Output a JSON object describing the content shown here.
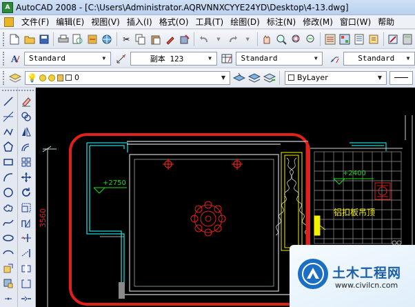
{
  "titlebar": {
    "icon_text": "A",
    "title": "AutoCAD 2008 - [C:\\Users\\Administrator.AQRVNNXCYYE24YD\\Desktop\\4-13.dwg]"
  },
  "menu": {
    "items": [
      "文件(F)",
      "编辑(E)",
      "视图(V)",
      "插入(I)",
      "格式(O)",
      "工具(T)",
      "绘图(D)",
      "标注(N)",
      "修改(M)",
      "窗口(W)",
      "帮助"
    ]
  },
  "styles_toolbar": {
    "text_style": "Standard",
    "dim_style": "副本 123",
    "table_style": "Standard",
    "multileader_style": "Standard"
  },
  "layers_toolbar": {
    "layer": "0",
    "color": "ByLayer"
  },
  "drawing": {
    "dim_vertical": "3560",
    "elevation_left": "+2750",
    "elevation_right": "+2400",
    "annotation": "铝扣板吊顶"
  },
  "watermark": {
    "title": "土木工程网",
    "url": "www.civilcn.com"
  },
  "colors": {
    "canvas": "#000000",
    "highlight": "#e0201a",
    "cyan": "#19d6d6",
    "yellow": "#f5f000",
    "green": "#18e018"
  }
}
